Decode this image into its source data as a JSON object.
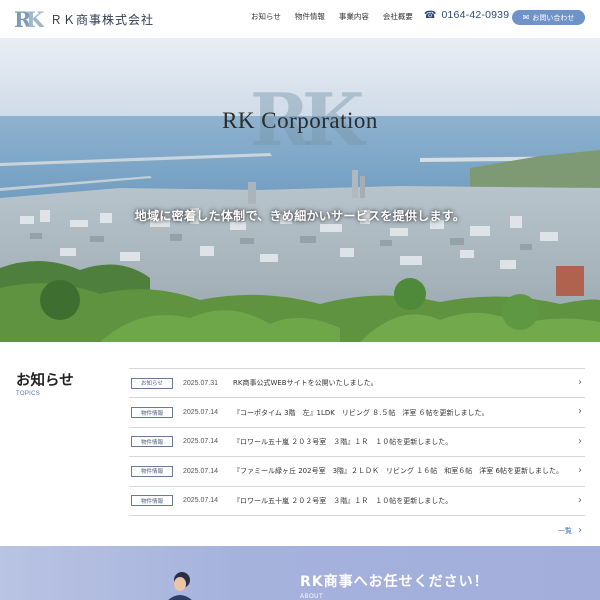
{
  "header": {
    "logo_mark": "RK",
    "company_name": "ＲＫ商事株式会社",
    "nav": [
      "お知らせ",
      "物件情報",
      "事業内容",
      "会社概要"
    ],
    "phone_icon": "phone-icon",
    "phone": "0164-42-0939",
    "contact_icon": "mail-icon",
    "contact_label": "お問い合わせ"
  },
  "hero": {
    "title": "RK Corporation",
    "subtitle": "地域に密着した体制で、きめ細かいサービスを提供します。"
  },
  "news": {
    "heading": "お知らせ",
    "subheading": "TOPICS",
    "items": [
      {
        "tag": "お知らせ",
        "date": "2025.07.31",
        "title": "RK商事公式WEBサイトを公開いたしました。"
      },
      {
        "tag": "物件情報",
        "date": "2025.07.14",
        "title": "『コーポタイム 3階　左』1LDK　リビング ８.５帖　洋室 ６帖を更新しました。"
      },
      {
        "tag": "物件情報",
        "date": "2025.07.14",
        "title": "『ロワール五十嵐 ２０３号室　３階』１Ｒ　１０帖を更新しました。"
      },
      {
        "tag": "物件情報",
        "date": "2025.07.14",
        "title": "『ファミール緑ヶ丘 202号室　3階』２ＬＤＫ　リビング １６帖　和室６帖　洋室 6帖を更新しました。"
      },
      {
        "tag": "物件情報",
        "date": "2025.07.14",
        "title": "『ロワール五十嵐 ２０２号室　３階』１Ｒ　１０帖を更新しました。"
      }
    ],
    "more_label": "一覧"
  },
  "about": {
    "title": "RK商事へお任せください！",
    "subtitle": "ABOUT"
  },
  "colors": {
    "accent": "#6f93c8",
    "navy": "#2d4a78",
    "about_band": "#a5b2dc"
  }
}
